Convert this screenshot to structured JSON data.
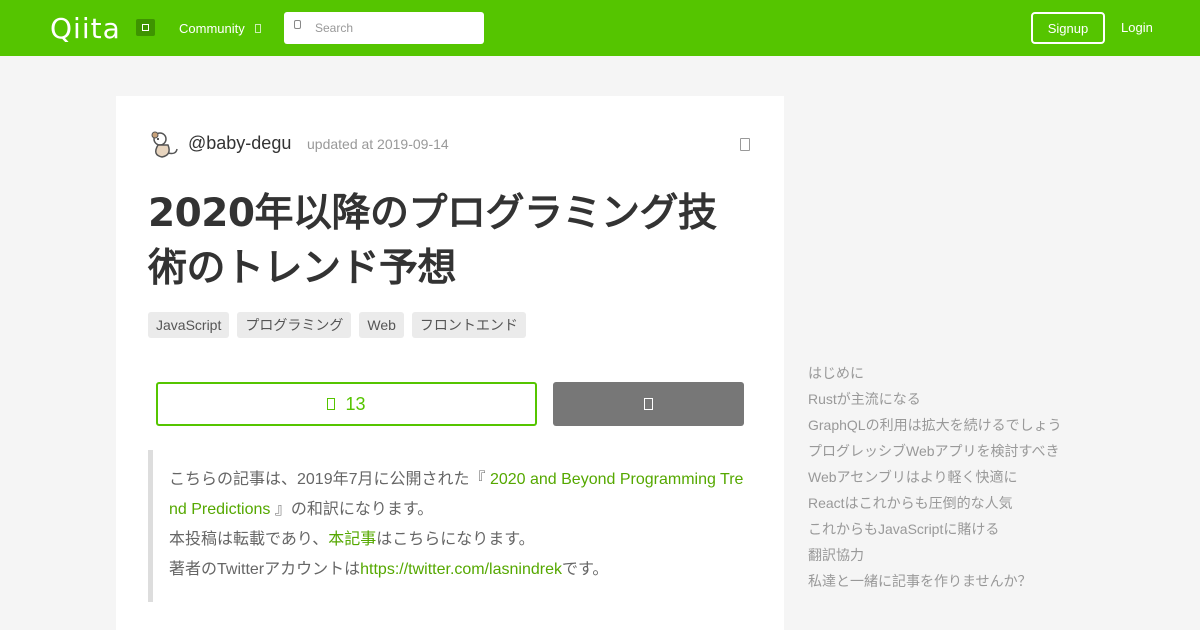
{
  "header": {
    "logo": "Qiita",
    "community": "Community",
    "search_placeholder": "Search",
    "signup": "Signup",
    "login": "Login"
  },
  "article": {
    "username": "@baby-degu",
    "updated": "updated at 2019-09-14",
    "title": "2020年以降のプログラミング技術のトレンド予想",
    "tags": [
      "JavaScript",
      "プログラミング",
      "Web",
      "フロントエンド"
    ],
    "likes": "13",
    "quote": {
      "line1_pre": "こちらの記事は、2019年7月に公開された『",
      "line1_link_a": "2020 and Beyond Programming Tre",
      "line2_link_b": "nd Predictions",
      "line2_post": "』の和訳になります。",
      "line3_pre": "本投稿は転載であり、",
      "line3_link": "本記事",
      "line3_post": "はこちらになります。",
      "line4_pre": "著者のTwitterアカウントは",
      "line4_link": "https://twitter.com/lasnindrek",
      "line4_post": "です。"
    }
  },
  "toc": [
    "はじめに",
    "Rustが主流になる",
    "GraphQLの利用は拡大を続けるでしょう",
    "プログレッシブWebアプリを検討すべき",
    "Webアセンブリはより軽く快適に",
    "Reactはこれからも圧倒的な人気",
    "これからもJavaScriptに賭ける",
    "翻訳協力",
    "私達と一緒に記事を作りませんか？"
  ],
  "colors": {
    "brand_green": "#55c500",
    "link_green": "#55a800"
  }
}
